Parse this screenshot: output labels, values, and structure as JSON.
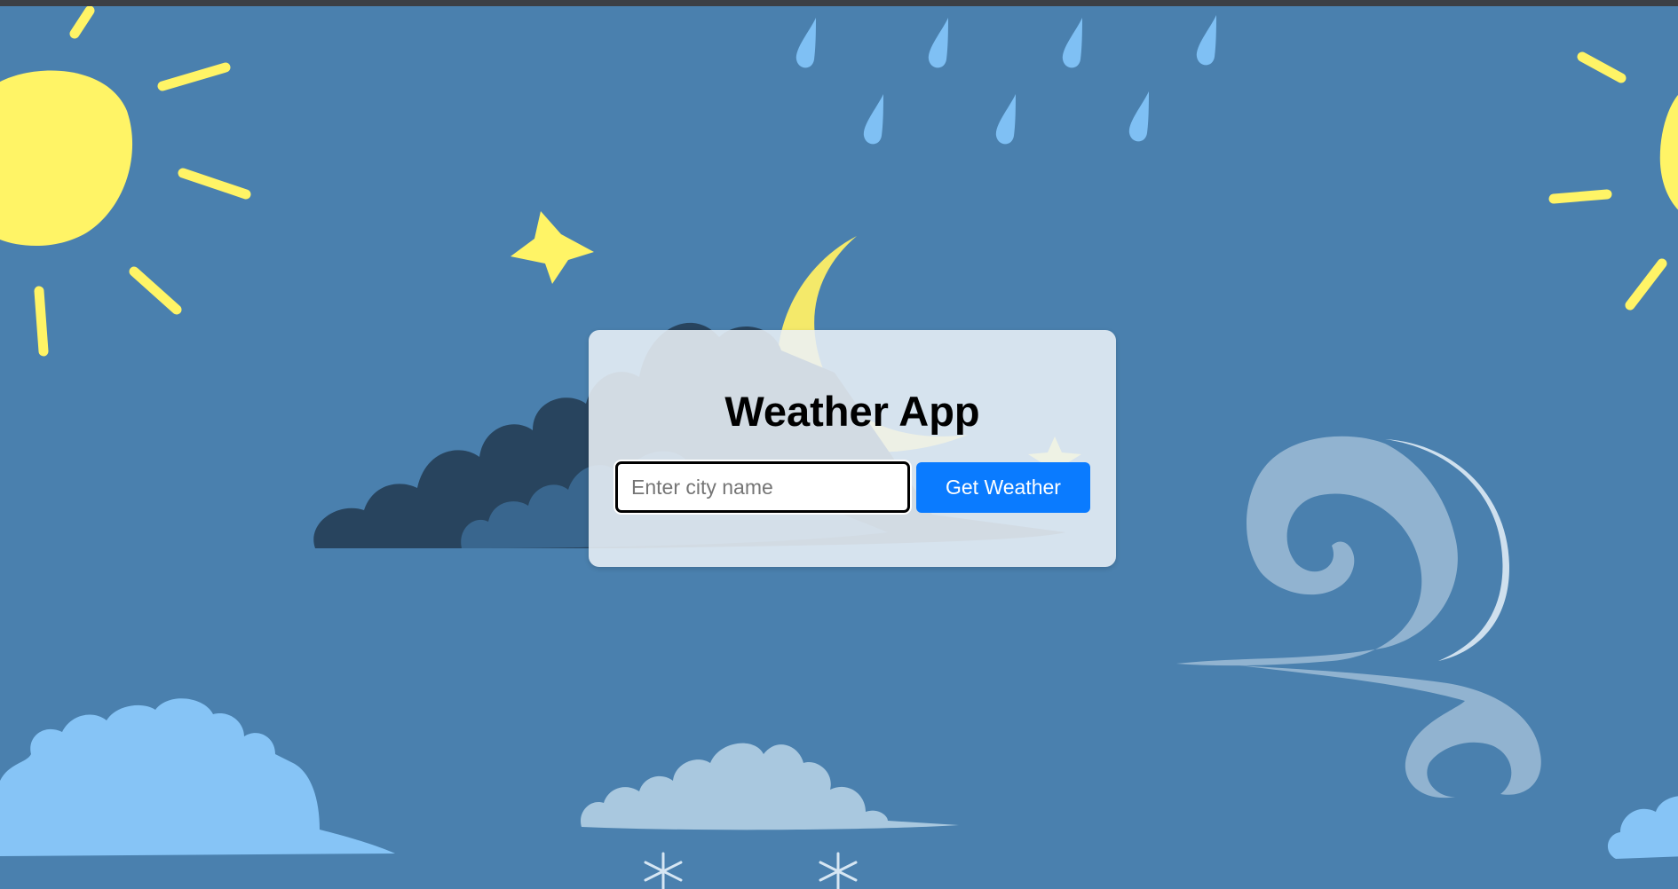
{
  "app": {
    "title": "Weather App"
  },
  "search": {
    "placeholder": "Enter city name",
    "value": ""
  },
  "actions": {
    "get_weather_label": "Get Weather"
  },
  "colors": {
    "background": "#4a80ae",
    "button": "#0a7bff",
    "sun": "#fff466",
    "moon": "#f4e96a",
    "raindrop": "#7fc0f4",
    "dark_cloud": "#28445e",
    "light_cloud": "#86c4f6",
    "pale_cloud": "#a9c8df",
    "wind": "#9dbcd6"
  },
  "icons": {
    "background": [
      "sun-icon",
      "raindrop-icon",
      "star-icon",
      "moon-icon",
      "cloud-icon",
      "wind-swirl-icon",
      "snowflake-icon"
    ]
  }
}
